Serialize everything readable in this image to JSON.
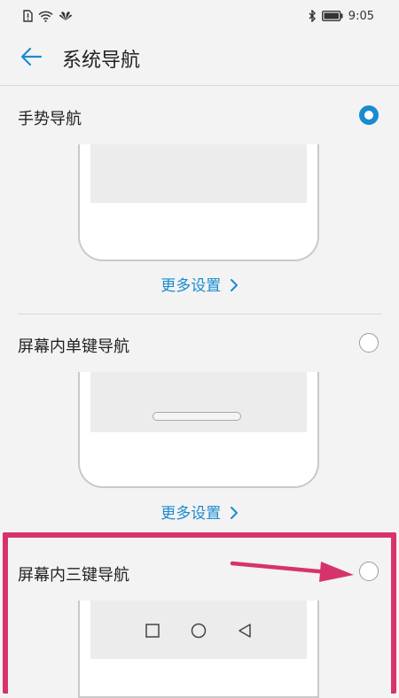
{
  "status_bar": {
    "time": "9:05",
    "icons_left": [
      "sim-alert-icon",
      "wifi-icon",
      "huawei-logo-icon"
    ],
    "icons_right": [
      "bluetooth-icon",
      "battery-icon"
    ]
  },
  "app_bar": {
    "title": "系统导航",
    "back_icon": "arrow-left-icon"
  },
  "options": [
    {
      "title": "手势导航",
      "selected": true,
      "more_label": "更多设置",
      "more_icon": "chevron-right-icon"
    },
    {
      "title": "屏幕内单键导航",
      "selected": false,
      "more_label": "更多设置",
      "more_icon": "chevron-right-icon"
    },
    {
      "title": "屏幕内三键导航",
      "selected": false,
      "nav_keys": [
        "square-icon",
        "circle-icon",
        "triangle-back-icon"
      ]
    }
  ],
  "colors": {
    "accent": "#1a8bcf",
    "highlight": "#d6336c",
    "background": "#f3f3f3"
  }
}
